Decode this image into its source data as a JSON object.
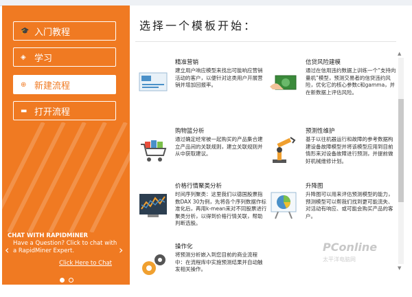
{
  "sidebar": {
    "buttons": [
      {
        "label": "入门教程",
        "icon": "graduation-icon"
      },
      {
        "label": "学习",
        "icon": "layers-icon"
      },
      {
        "label": "新建流程",
        "icon": "plus-circle-icon"
      },
      {
        "label": "打开流程",
        "icon": "folder-icon"
      }
    ],
    "chat": {
      "title": "CHAT WITH RAPIDMINER",
      "text": "Have a Question? Click to chat with a RapidMiner Expert.",
      "link": "Click Here to Chat"
    }
  },
  "main": {
    "heading": "选择一个模板开始：",
    "templates": [
      {
        "title": "精准营销",
        "desc": "建立用户响应模型来找出可能响应营销活动的客户，以便针对这类用户开展营销并增加回报率。",
        "icon": "email-icon"
      },
      {
        "title": "信贷风险建模",
        "desc": "通过在信用违约数据上训练一个“支持向量机”模型，预测交易者的信贷违约风险，优化它的核心参数c和gamma，并在新数据上评估风险。",
        "icon": "money-icon"
      },
      {
        "title": "购物篮分析",
        "desc": "通过确定经常被一起购买的产品集合建立产品间的关联规则，建立关联规则并从中获取建议。",
        "icon": "cart-icon"
      },
      {
        "title": "预测性维护",
        "desc": "基于以往机器运行和故障的参考数据构建设备故障模型并将该模型应用到目前情形来对设备故障进行预测，并提前做好机械维修计划。",
        "icon": "robot-arm-icon"
      },
      {
        "title": "价格行情聚类分析",
        "desc": "时间序列聚类：这里我们以德国股票指数DAX 30为例，先将各个序列数据作标准化后，再用k-mean来对不同股票进行聚类分析，以得到价格行情关联，帮助判断选股。",
        "icon": "candlestick-chart-icon"
      },
      {
        "title": "升降图",
        "desc": "升降图可以用来评估预测模型的能力，预测模型可以帮我们找到更可能流失、对活动有响应、或可能会购买产品的客户。",
        "icon": "pie-chart-icon"
      },
      {
        "title": "操作化",
        "desc": "将预测分析嵌入到您目前的商业流程中：在流程库中实施预测结果并自动触发相关操作。",
        "icon": "gears-icon"
      }
    ]
  },
  "watermark": {
    "brand": "PConline",
    "sub": "太平洋电脑网"
  },
  "colors": {
    "accent": "#f07a22"
  }
}
